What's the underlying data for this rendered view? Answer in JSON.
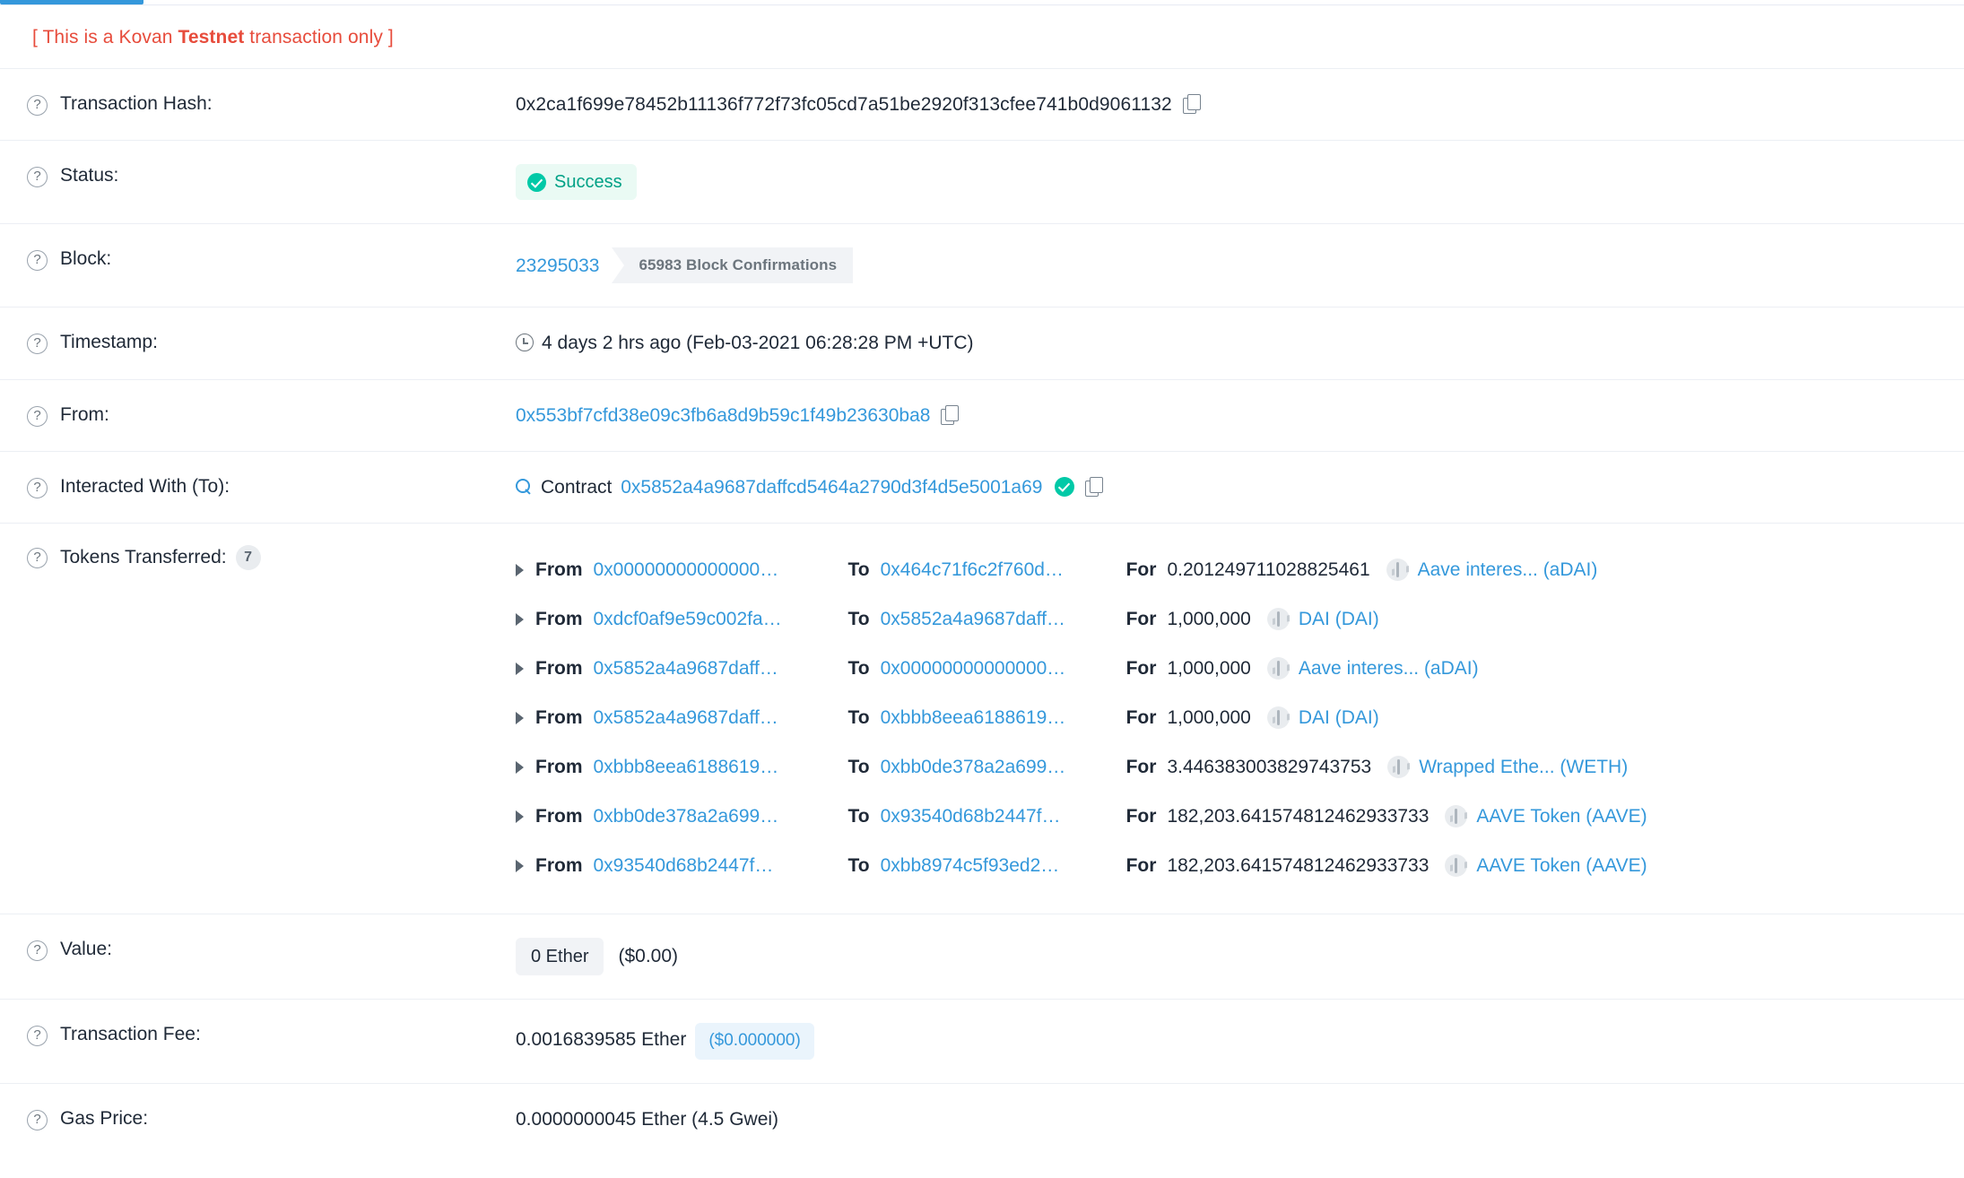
{
  "banner": {
    "prefix": "[ This is a Kovan ",
    "bold": "Testnet",
    "suffix": " transaction only ]"
  },
  "rows": {
    "tx_hash": {
      "label": "Transaction Hash:",
      "value": "0x2ca1f699e78452b11136f772f73fc05cd7a51be2920f313cfee741b0d9061132",
      "copy_icon": "copy-icon",
      "help_icon": "help-icon"
    },
    "status": {
      "label": "Status:",
      "value": "Success",
      "status_color": "#00a186",
      "badge_bg": "#eafaf4",
      "check_icon": "check-circle-icon"
    },
    "block": {
      "label": "Block:",
      "number": "23295033",
      "confirmations": "65983 Block Confirmations"
    },
    "timestamp": {
      "label": "Timestamp:",
      "value": "4 days 2 hrs ago (Feb-03-2021 06:28:28 PM +UTC)",
      "clock_icon": "clock-icon"
    },
    "from": {
      "label": "From:",
      "address": "0x553bf7cfd38e09c3fb6a8d9b59c1f49b23630ba8",
      "copy_icon": "copy-icon"
    },
    "to": {
      "label": "Interacted With (To):",
      "magnifier_icon": "magnifier-icon",
      "contract_word": "Contract",
      "address": "0x5852a4a9687daffcd5464a2790d3f4d5e5001a69",
      "verified_icon": "verified-check-icon",
      "copy_icon": "copy-icon"
    },
    "tokens": {
      "label": "Tokens Transferred:",
      "count": "7",
      "kw_from": "From",
      "kw_to": "To",
      "kw_for": "For",
      "items": [
        {
          "from": "0x00000000000000…",
          "to": "0x464c71f6c2f760d…",
          "amount": "0.201249711028825461",
          "token": "Aave interes... (aDAI)"
        },
        {
          "from": "0xdcf0af9e59c002fa…",
          "to": "0x5852a4a9687daff…",
          "amount": "1,000,000",
          "token": "DAI (DAI)"
        },
        {
          "from": "0x5852a4a9687daff…",
          "to": "0x00000000000000…",
          "amount": "1,000,000",
          "token": "Aave interes... (aDAI)"
        },
        {
          "from": "0x5852a4a9687daff…",
          "to": "0xbbb8eea6188619…",
          "amount": "1,000,000",
          "token": "DAI (DAI)"
        },
        {
          "from": "0xbbb8eea6188619…",
          "to": "0xbb0de378a2a699…",
          "amount": "3.446383003829743753",
          "token": "Wrapped Ethe... (WETH)"
        },
        {
          "from": "0xbb0de378a2a699…",
          "to": "0x93540d68b2447f…",
          "amount": "182,203.641574812462933733",
          "token": "AAVE Token (AAVE)"
        },
        {
          "from": "0x93540d68b2447f…",
          "to": "0xbb8974c5f93ed2…",
          "amount": "182,203.641574812462933733",
          "token": "AAVE Token (AAVE)"
        }
      ]
    },
    "value": {
      "label": "Value:",
      "ether": "0 Ether",
      "usd": "($0.00)"
    },
    "fee": {
      "label": "Transaction Fee:",
      "ether": "0.0016839585 Ether",
      "usd": "($0.000000)"
    },
    "gas_price": {
      "label": "Gas Price:",
      "value": "0.0000000045 Ether (4.5 Gwei)"
    }
  }
}
